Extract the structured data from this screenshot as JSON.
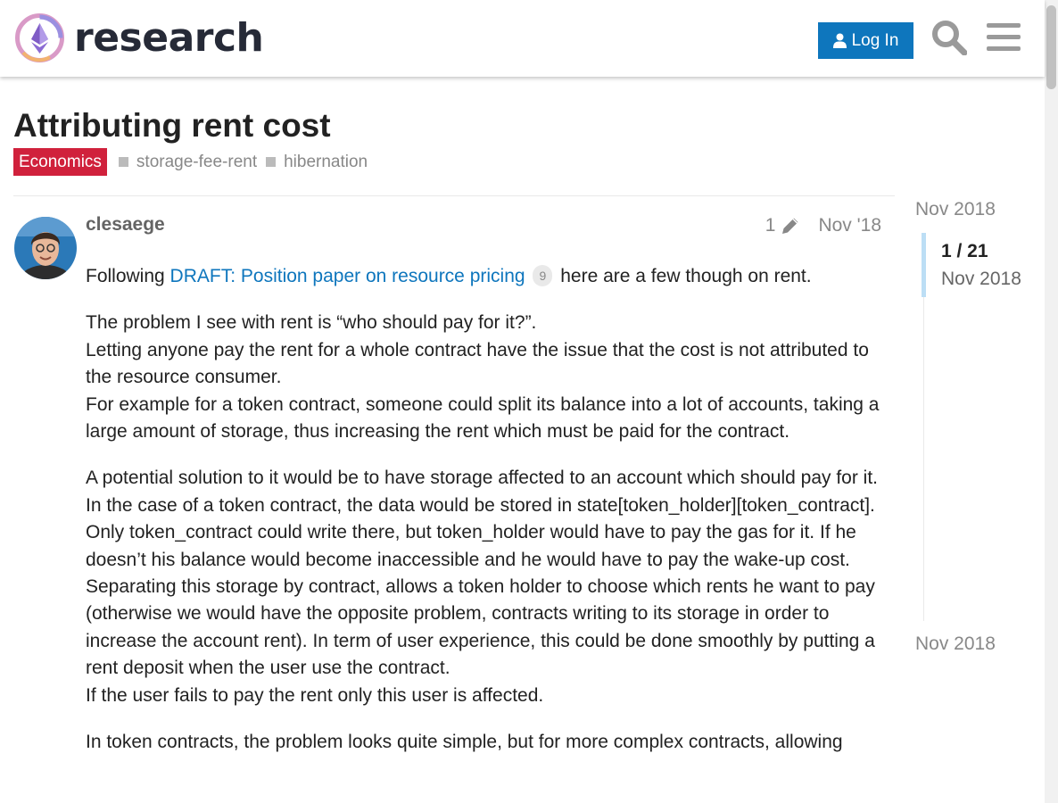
{
  "header": {
    "logo_text": "research",
    "login_label": "Log In"
  },
  "topic": {
    "title": "Attributing rent cost",
    "category": "Economics",
    "tags": [
      "storage-fee-rent",
      "hibernation"
    ]
  },
  "post": {
    "username": "clesaege",
    "edit_count": "1",
    "date": "Nov '18",
    "link_text": "DRAFT: Position paper on resource pricing",
    "link_clicks": "9",
    "paragraphs": {
      "p1_before": "Following ",
      "p1_after": " here are a few though on rent.",
      "p2": "The problem I see with rent is “who should pay for it?”.\nLetting anyone pay the rent for a whole contract have the issue that the cost is not attributed to the resource consumer.\nFor example for a token contract, someone could split its balance into a lot of accounts, taking a large amount of storage, thus increasing the rent which must be paid for the contract.",
      "p3": "A potential solution to it would be to have storage affected to an account which should pay for it. In the case of a token contract, the data would be stored in state[token_holder][token_contract]. Only token_contract could write there, but token_holder would have to pay the gas for it. If he doesn’t his balance would become inaccessible and he would have to pay the wake-up cost.\nSeparating this storage by contract, allows a token holder to choose which rents he want to pay (otherwise we would have the opposite problem, contracts writing to its storage in order to increase the account rent). In term of user experience, this could be done smoothly by putting a rent deposit when the user use the contract.\nIf the user fails to pay the rent only this user is affected.",
      "p4": "In token contracts, the problem looks quite simple, but for more complex contracts, allowing"
    }
  },
  "timeline": {
    "start_date": "Nov 2018",
    "position": "1 / 21",
    "position_date": "Nov 2018",
    "end_date": "Nov 2018"
  },
  "colors": {
    "accent": "#0e76bd",
    "category": "#d0213c"
  },
  "icons": [
    "user-icon",
    "search-icon",
    "hamburger-menu-icon",
    "pencil-icon"
  ]
}
